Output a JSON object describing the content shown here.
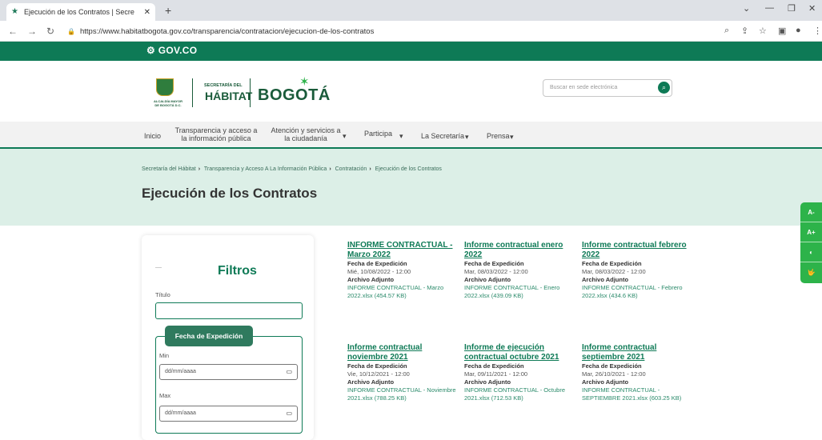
{
  "browser": {
    "tab_title": "Ejecución de los Contratos | Secre",
    "url": "https://www.habitatbogota.gov.co/transparencia/contratacion/ejecucion-de-los-contratos"
  },
  "gov_logo": "GOV.CO",
  "header": {
    "alcaldia": "ALCALDÍA MAYOR DE BOGOTÁ D.C.",
    "secretaria_small": "SECRETARÍA DEL",
    "habitat": "HÁBITAT",
    "bogota": "BOGOTÁ",
    "search_placeholder": "Buscar en sede electrónica"
  },
  "menu": {
    "inicio": "Inicio",
    "transparencia_1": "Transparencia y acceso a",
    "transparencia_2": "la información pública",
    "atencion_1": "Atención y servicios a",
    "atencion_2": "la ciudadanía",
    "participa": "Participa",
    "secretaria": "La Secretaría",
    "prensa": "Prensa"
  },
  "breadcrumb": {
    "b1": "Secretaría del Hábitat",
    "b2": "Transparencia y Acceso A La Información Pública",
    "b3": "Contratación",
    "b4": "Ejecución de los Contratos"
  },
  "page_title": "Ejecución de los Contratos",
  "access": {
    "a_minus": "A-",
    "a_plus": "A+",
    "contrast": "◐",
    "sign": "🤟"
  },
  "filters": {
    "title": "Filtros",
    "titulo_label": "Título",
    "fecha_label": "Fecha de Expedición",
    "min_label": "Min",
    "max_label": "Max",
    "date_placeholder": "dd/mm/aaaa"
  },
  "labels": {
    "fecha": "Fecha de Expedición",
    "archivo": "Archivo Adjunto"
  },
  "cards": [
    {
      "title": "INFORME CONTRACTUAL - Marzo 2022",
      "date": "Mié, 10/08/2022 - 12:00",
      "file": "INFORME CONTRACTUAL - Marzo 2022.xlsx (454.57 KB)"
    },
    {
      "title": "Informe contractual enero 2022",
      "date": "Mar, 08/03/2022 - 12:00",
      "file": "INFORME CONTRACTUAL - Enero 2022.xlsx (439.09 KB)"
    },
    {
      "title": "Informe contractual febrero 2022",
      "date": "Mar, 08/03/2022 - 12:00",
      "file": "INFORME CONTRACTUAL - Febrero 2022.xlsx (434.6 KB)"
    },
    {
      "title": "Informe contractual noviembre 2021",
      "date": "Vie, 10/12/2021 - 12:00",
      "file": "INFORME CONTRACTUAL - Noviembre 2021.xlsx (788.25 KB)"
    },
    {
      "title": "Informe de ejecución contractual octubre 2021",
      "date": "Mar, 09/11/2021 - 12:00",
      "file": "INFORME CONTRACTUAL - Octubre 2021.xlsx (712.53 KB)"
    },
    {
      "title": "Informe contractual septiembre 2021",
      "date": "Mar, 26/10/2021 - 12:00",
      "file": "INFORME CONTRACTUAL - SEPTIEMBRE 2021.xlsx (603.25 KB)"
    }
  ]
}
